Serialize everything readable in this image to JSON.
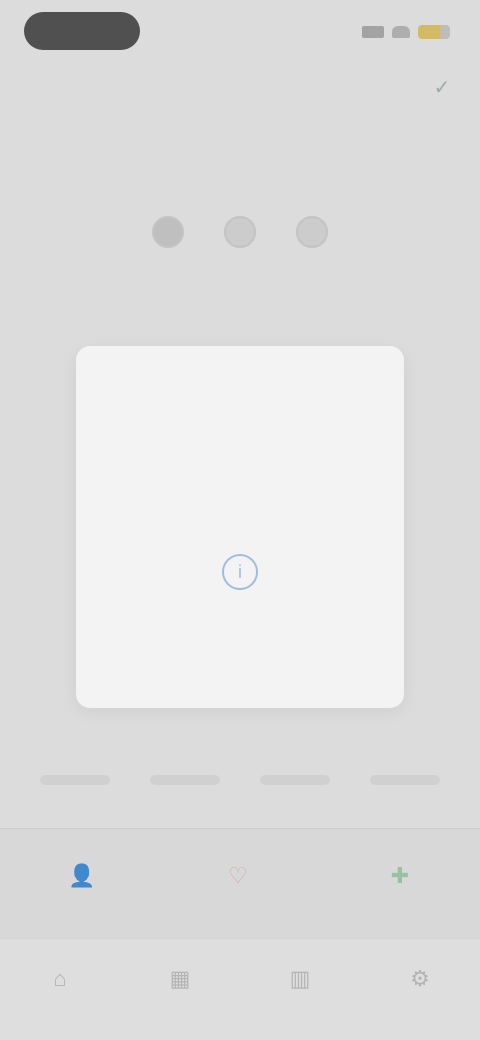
{
  "header": {
    "title": "",
    "action_icon": "check-icon"
  },
  "steps": {
    "count": 3,
    "active_index": 0
  },
  "page": {
    "title": "",
    "subtitle": ""
  },
  "dialog": {
    "title": "",
    "body": "",
    "icon": "info-icon",
    "primary_label": "",
    "secondary_label": ""
  },
  "actions": [
    {
      "icon": "person-icon",
      "label": ""
    },
    {
      "icon": "heart-icon",
      "label": ""
    },
    {
      "icon": "plus-icon",
      "label": ""
    }
  ],
  "tabs": [
    {
      "icon": "home-icon"
    },
    {
      "icon": "calendar-icon"
    },
    {
      "icon": "chart-icon"
    },
    {
      "icon": "settings-icon"
    }
  ],
  "colors": {
    "accent": "#9fbde0",
    "primary_link": "#8fb2de",
    "green": "#8fbf98",
    "rose": "#d4a9a2"
  }
}
